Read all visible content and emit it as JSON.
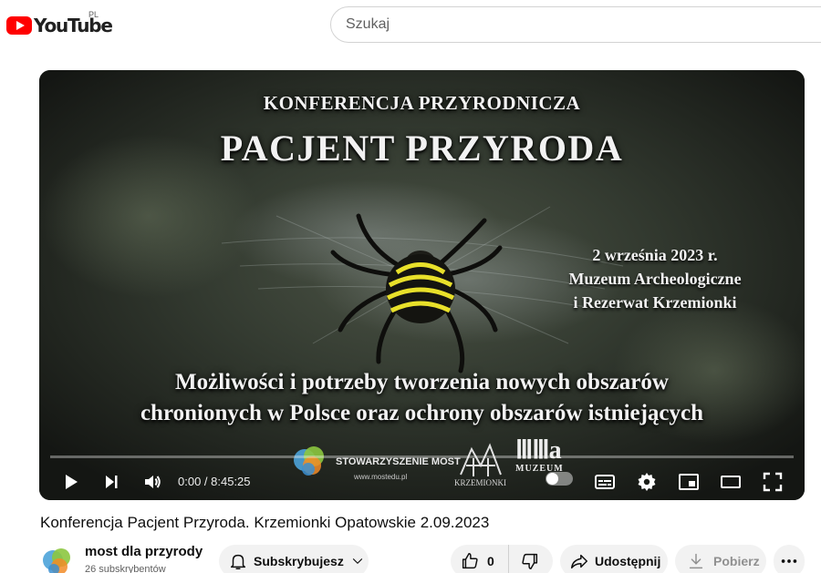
{
  "header": {
    "logo_text": "YouTube",
    "region": "PL",
    "search_placeholder": "Szukaj"
  },
  "video": {
    "overlay": {
      "conference": "KONFERENCJA PRZYRODNICZA",
      "main_title": "PACJENT PRZYRODA",
      "date_line1": "2 września 2023 r.",
      "date_line2": "Muzeum Archeologiczne",
      "date_line3": "i Rezerwat Krzemionki",
      "subtitle_line1": "Możliwości i potrzeby tworzenia nowych obszarów",
      "subtitle_line2": "chronionych w Polsce oraz ochrony obszarów istniejących"
    },
    "sponsors": {
      "most_label": "STOWARZYSZENIE MOST",
      "most_url": "www.mostedu.pl",
      "krzemionki": "KRZEMIONKI",
      "muzeum": "MUZEUM"
    },
    "controls": {
      "time": "0:00 / 8:45:25",
      "progress": 0
    }
  },
  "title": "Konferencja Pacjent Przyroda. Krzemionki Opatowskie 2.09.2023",
  "channel": {
    "name": "most dla przyrody",
    "subscribers": "26 subskrybentów"
  },
  "actions": {
    "subscribe_label": "Subskrybujesz",
    "like_count": "0",
    "share_label": "Udostępnij",
    "download_label": "Pobierz"
  },
  "colors": {
    "brand": "#ff0000",
    "pill_bg": "#f2f2f2",
    "spider_yellow": "#e8e02a"
  },
  "icons": [
    "youtube-logo-icon",
    "play-icon",
    "next-icon",
    "volume-icon",
    "subtitles-icon",
    "settings-icon",
    "miniplayer-icon",
    "theater-icon",
    "fullscreen-icon",
    "bell-icon",
    "chevron-down-icon",
    "thumbs-up-icon",
    "thumbs-down-icon",
    "share-icon",
    "download-icon",
    "more-icon"
  ]
}
